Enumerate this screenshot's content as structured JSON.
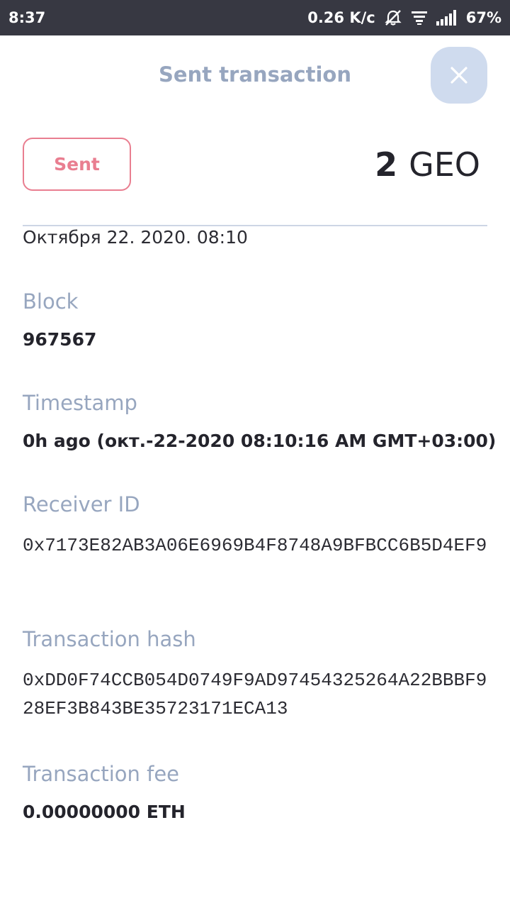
{
  "status_bar": {
    "time": "8:37",
    "network_speed": "0.26 K/c",
    "battery": "67%",
    "icons": [
      "alarm-off-icon",
      "notification-icon",
      "signal-icon"
    ]
  },
  "header": {
    "title": "Sent transaction",
    "close_icon": "close-icon"
  },
  "summary": {
    "status": "Sent",
    "amount": "2",
    "currency": "GEO",
    "date": "Октября 22. 2020. 08:10"
  },
  "fields": {
    "block": {
      "label": "Block",
      "value": "967567"
    },
    "timestamp": {
      "label": "Timestamp",
      "value": "0h ago (окт.-22-2020 08:10:16 AM GMT+03:00)"
    },
    "receiver": {
      "label": "Receiver ID",
      "value": "0x7173E82AB3A06E6969B4F8748A9BFBCC6B5D4EF9"
    },
    "hash": {
      "label": "Transaction hash",
      "value": "0xDD0F74CCB054D0749F9AD97454325264A22BBBF928EF3B843BE35723171ECA13"
    },
    "fee": {
      "label": "Transaction fee",
      "value": "0.00000000 ETH"
    }
  },
  "colors": {
    "status_bar_bg": "#373842",
    "label": "#97a6bf",
    "sent_accent": "#e97e90",
    "close_button_bg": "#cfdbee"
  }
}
